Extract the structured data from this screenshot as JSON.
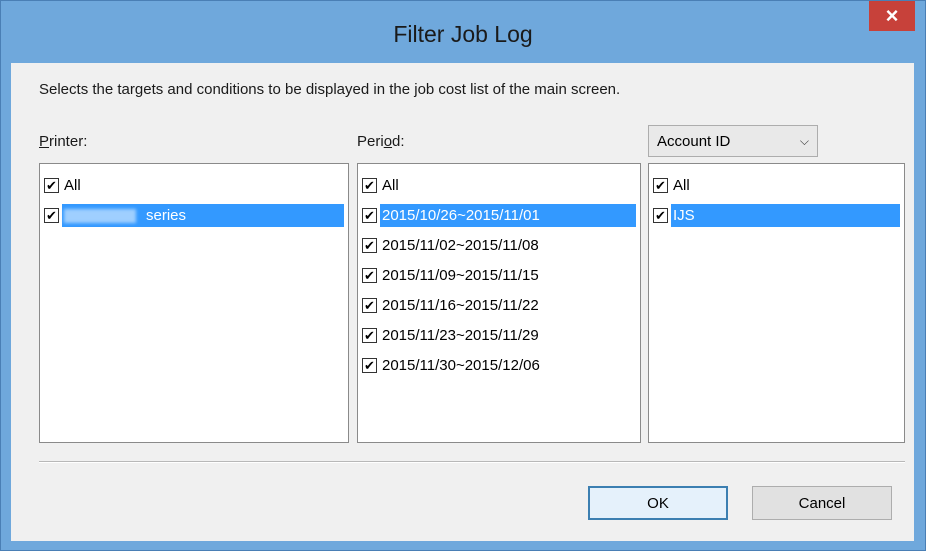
{
  "window": {
    "title": "Filter Job Log",
    "close_symbol": "×"
  },
  "description": "Selects the targets and conditions to be displayed in the job cost list of the main screen.",
  "printer": {
    "label_prefix": "P",
    "label_rest": "rinter:",
    "items": [
      {
        "label": "All",
        "checked": true,
        "selected": false
      },
      {
        "label": "series",
        "checked": true,
        "selected": true
      }
    ]
  },
  "period": {
    "label_prefix": "Peri",
    "label_underline": "o",
    "label_rest": "d:",
    "items": [
      {
        "label": "All",
        "checked": true,
        "selected": false
      },
      {
        "label": "2015/10/26~2015/11/01",
        "checked": true,
        "selected": true
      },
      {
        "label": "2015/11/02~2015/11/08",
        "checked": true,
        "selected": false
      },
      {
        "label": "2015/11/09~2015/11/15",
        "checked": true,
        "selected": false
      },
      {
        "label": "2015/11/16~2015/11/22",
        "checked": true,
        "selected": false
      },
      {
        "label": "2015/11/23~2015/11/29",
        "checked": true,
        "selected": false
      },
      {
        "label": "2015/11/30~2015/12/06",
        "checked": true,
        "selected": false
      }
    ]
  },
  "account": {
    "select_value": "Account ID",
    "items": [
      {
        "label": "All",
        "checked": true,
        "selected": false
      },
      {
        "label": "IJS",
        "checked": true,
        "selected": true
      }
    ]
  },
  "buttons": {
    "ok": "OK",
    "cancel": "Cancel"
  },
  "check_glyph": "✔",
  "colors": {
    "selection": "#3399ff",
    "title_bar": "#6fa8dc",
    "close_button": "#c7413a"
  }
}
